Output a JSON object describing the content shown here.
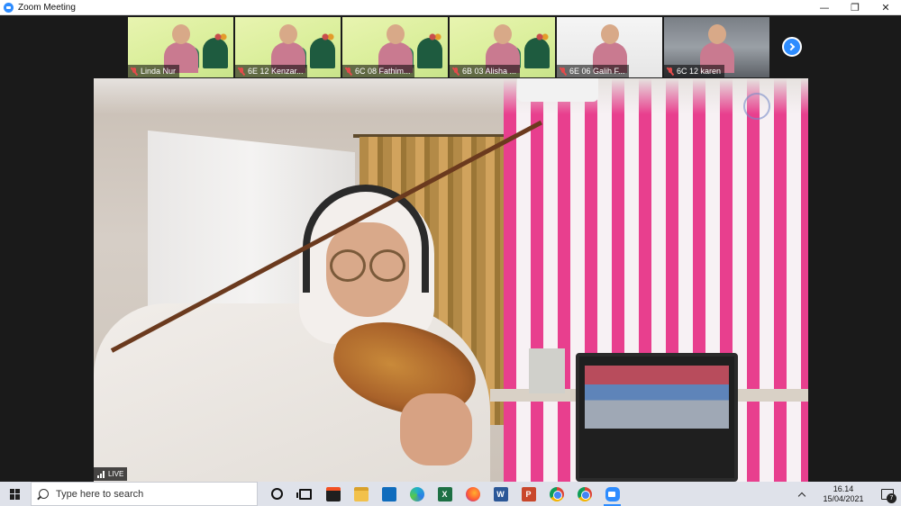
{
  "window": {
    "title": "Zoom Meeting",
    "minimize_glyph": "—",
    "restore_glyph": "❐",
    "close_glyph": "✕"
  },
  "participants": [
    {
      "name": "Linda Nur",
      "muted": true,
      "bg": "eid"
    },
    {
      "name": "6E 12 Kenzar...",
      "muted": true,
      "bg": "eid"
    },
    {
      "name": "6C 08 Fathim...",
      "muted": true,
      "bg": "eid"
    },
    {
      "name": "6B 03 Alisha ...",
      "muted": true,
      "bg": "eid"
    },
    {
      "name": "6E 06 Galih F...",
      "muted": true,
      "bg": "white"
    },
    {
      "name": "6C 12 karen",
      "muted": true,
      "bg": "room"
    }
  ],
  "main_video": {
    "live_label": "LIVE"
  },
  "taskbar": {
    "search_placeholder": "Type here to search",
    "apps": [
      {
        "name": "cortana",
        "icon": "cortana-icon"
      },
      {
        "name": "task-view",
        "icon": "taskview-icon"
      },
      {
        "name": "microsoft-store",
        "icon": "store-icon"
      },
      {
        "name": "file-explorer",
        "icon": "explorer-icon"
      },
      {
        "name": "mail",
        "icon": "mail-icon"
      },
      {
        "name": "edge",
        "icon": "edge-icon"
      },
      {
        "name": "excel",
        "icon": "excel-icon",
        "letter": "X"
      },
      {
        "name": "firefox",
        "icon": "firefox-icon"
      },
      {
        "name": "word",
        "icon": "word-icon",
        "letter": "W"
      },
      {
        "name": "powerpoint",
        "icon": "ppt-icon",
        "letter": "P"
      },
      {
        "name": "chrome",
        "icon": "chrome-icon"
      },
      {
        "name": "chrome-profile",
        "icon": "chrome-icon"
      },
      {
        "name": "zoom",
        "icon": "zoom-icon",
        "active": true
      }
    ],
    "time": "16.14",
    "date": "15/04/2021",
    "notification_count": "7"
  },
  "colors": {
    "zoom_blue": "#2d8cff",
    "muted_red": "#e24b4b",
    "taskbar_bg": "#dfe2ea"
  }
}
